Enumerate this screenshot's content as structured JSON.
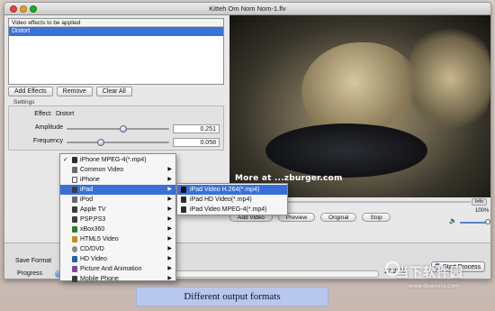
{
  "window": {
    "title": "Kitteh Om Nom Nom-1.flv"
  },
  "effects": {
    "header": "Video effects to be applied",
    "items": [
      "Distort"
    ],
    "buttons": {
      "add": "Add Effects",
      "remove": "Remove",
      "clear": "Clear All"
    }
  },
  "settings": {
    "label": "Settings",
    "effect_label": "Effect:",
    "effect_name": "Distort",
    "amplitude": {
      "label": "Amplitude",
      "value": "0.251",
      "level": 0.25
    },
    "frequency": {
      "label": "Frequency",
      "value": "0.058",
      "level": 0.3
    }
  },
  "video": {
    "watermark": "More at ...zburger.com",
    "info": "Info"
  },
  "controls": {
    "add_video": "Add Video",
    "preview": "Preview",
    "original": "Original",
    "stop": "Stop"
  },
  "volume": {
    "percent": "100%",
    "level": 1.0
  },
  "bottom": {
    "save_format": "Save Format",
    "progress": "Progress",
    "progress_value": "27.27%",
    "progress_fraction": 0.2727,
    "start": "Start Process"
  },
  "menu": {
    "items": [
      {
        "label": "iPhone MPEG-4(*.mp4)",
        "checked": true,
        "submenu": false
      },
      {
        "label": "Common Video",
        "checked": false,
        "submenu": true
      },
      {
        "label": "iPhone",
        "checked": false,
        "submenu": true
      },
      {
        "label": "iPad",
        "checked": false,
        "submenu": true,
        "highlighted": true
      },
      {
        "label": "iPod",
        "checked": false,
        "submenu": true
      },
      {
        "label": "Apple TV",
        "checked": false,
        "submenu": true
      },
      {
        "label": "PSP,PS3",
        "checked": false,
        "submenu": true
      },
      {
        "label": "xBox360",
        "checked": false,
        "submenu": true
      },
      {
        "label": "HTML5 Video",
        "checked": false,
        "submenu": true
      },
      {
        "label": "CD/DVD",
        "checked": false,
        "submenu": true
      },
      {
        "label": "HD Video",
        "checked": false,
        "submenu": true
      },
      {
        "label": "Picture And Animation",
        "checked": false,
        "submenu": true
      },
      {
        "label": "Mobile Phone",
        "checked": false,
        "submenu": true
      }
    ],
    "check_glyph": "✓",
    "arrow_glyph": "▶"
  },
  "submenu": {
    "items": [
      "iPad Video H.264(*.mp4)",
      "iPad HD Video(*.mp4)",
      "iPad Video MPEG-4(*.mp4)"
    ]
  },
  "caption": "Different output formats",
  "brand": {
    "main": "当下软件园",
    "url": "www.downxia.com"
  },
  "colors": {
    "highlight": "#3b6fd8",
    "caption_bg": "#b7c7ee"
  }
}
